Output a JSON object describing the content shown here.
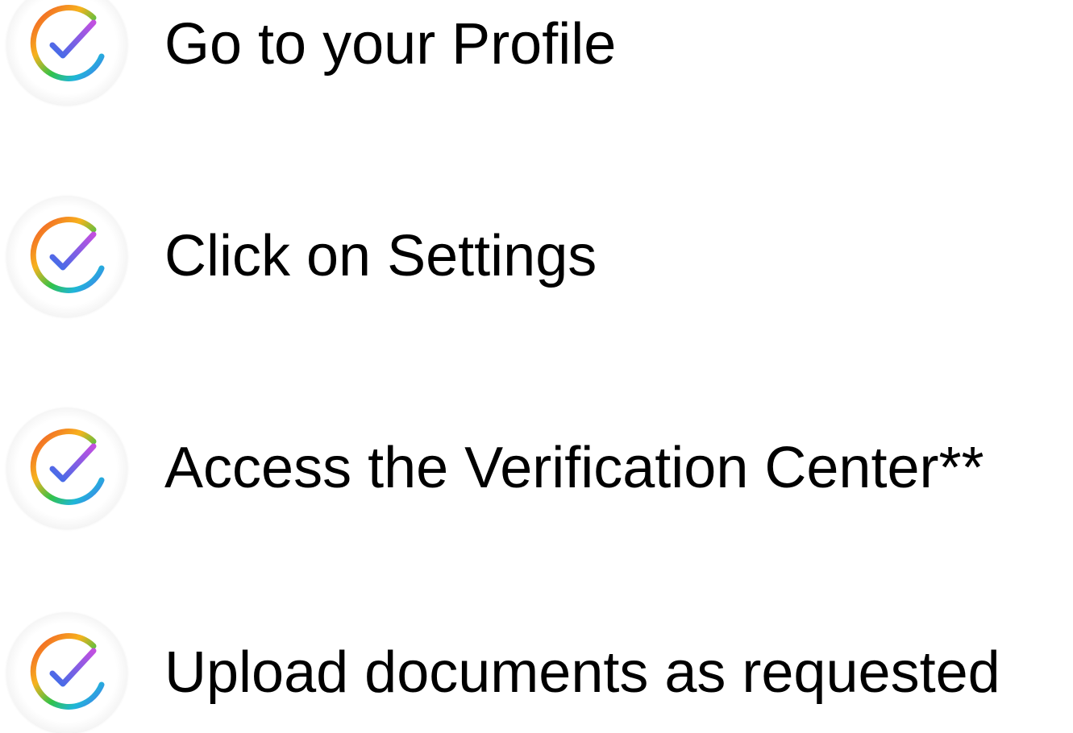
{
  "steps": [
    {
      "label": "Go to your Profile",
      "icon": "check-circle-icon"
    },
    {
      "label": "Click on Settings",
      "icon": "check-circle-icon"
    },
    {
      "label": "Access the Verification Center**",
      "icon": "check-circle-icon"
    },
    {
      "label": "Upload documents as requested",
      "icon": "check-circle-icon"
    }
  ],
  "colors": {
    "text": "#000000",
    "ring_gradient": [
      "#f0502a",
      "#f7b21d",
      "#31c24a",
      "#1fb6d8",
      "#4a73f0",
      "#c24fe0"
    ],
    "check": "#3b6ee8"
  }
}
